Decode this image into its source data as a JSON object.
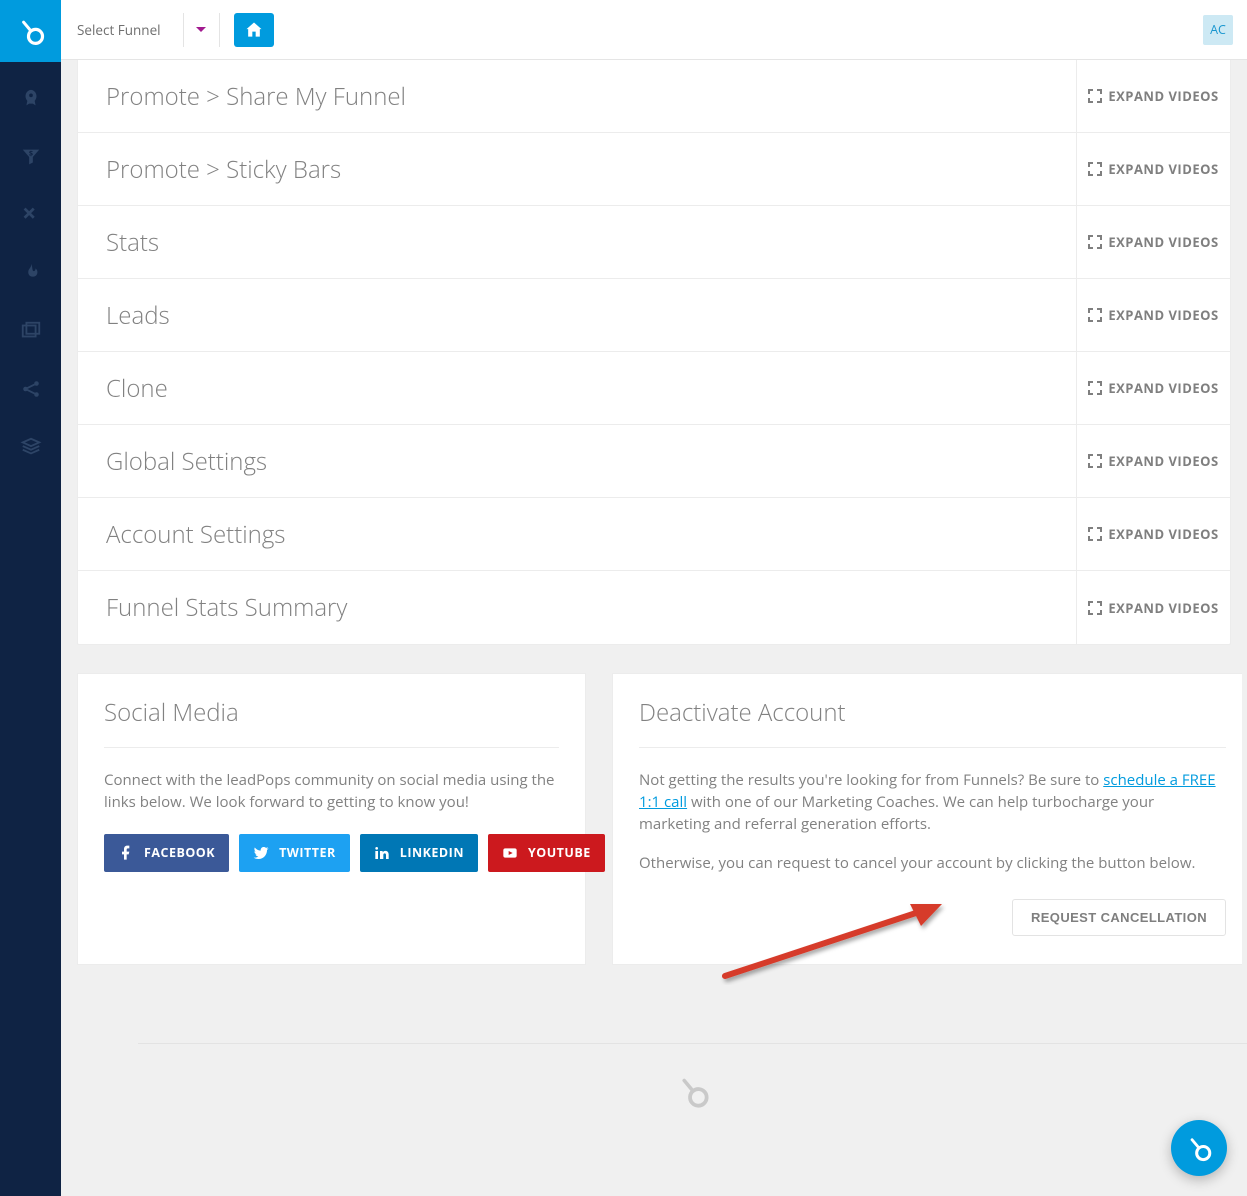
{
  "topbar": {
    "select_label": "Select Funnel",
    "avatar_initials": "AC"
  },
  "accordion": {
    "expand_label": "EXPAND VIDEOS",
    "items": [
      {
        "title": "Promote > Share My Funnel"
      },
      {
        "title": "Promote > Sticky Bars"
      },
      {
        "title": "Stats"
      },
      {
        "title": "Leads"
      },
      {
        "title": "Clone"
      },
      {
        "title": "Global Settings"
      },
      {
        "title": "Account Settings"
      },
      {
        "title": "Funnel Stats Summary"
      }
    ]
  },
  "social_card": {
    "heading": "Social Media",
    "body": "Connect with the leadPops community on social media using the links below. We look forward to getting to know you!",
    "buttons": {
      "facebook": "FACEBOOK",
      "twitter": "TWITTER",
      "linkedin": "LINKEDIN",
      "youtube": "YOUTUBE"
    }
  },
  "deactivate_card": {
    "heading": "Deactivate Account",
    "p1_a": "Not getting the results you're looking for from Funnels? Be sure to ",
    "link_text": "schedule a FREE 1:1 call",
    "p1_b": " with one of our Marketing Coaches. We can help turbocharge your marketing and referral generation efforts.",
    "p2": "Otherwise, you can request to cancel your account by clicking the button below.",
    "button": "REQUEST CANCELLATION"
  }
}
